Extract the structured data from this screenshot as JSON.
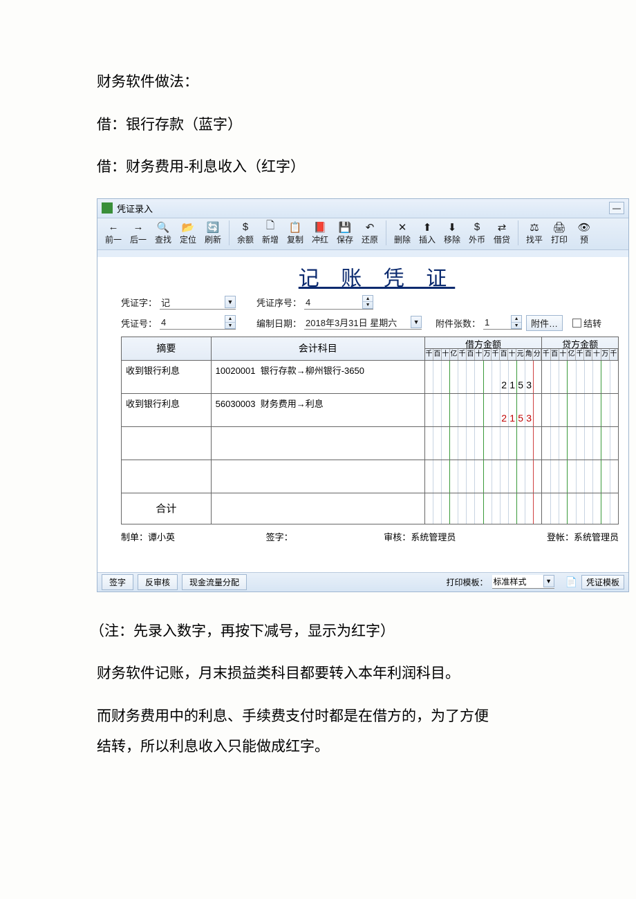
{
  "doc": {
    "p1": "财务软件做法：",
    "p2": "借：银行存款（蓝字）",
    "p3": "借：财务费用-利息收入（红字）",
    "note": "（注：先录入数字，再按下减号，显示为红字）",
    "p4": "财务软件记账，月末损益类科目都要转入本年利润科目。",
    "p5": "而财务费用中的利息、手续费支付时都是在借方的，为了方便",
    "p6": "结转，所以利息收入只能做成红字。"
  },
  "app": {
    "title": "凭证录入",
    "toolbar": [
      "前一",
      "后一",
      "查找",
      "定位",
      "刷新",
      "余额",
      "新增",
      "复制",
      "冲红",
      "保存",
      "还原",
      "删除",
      "插入",
      "移除",
      "外币",
      "借贷",
      "找平",
      "打印",
      "预"
    ],
    "voucher_title": "记 账 凭 证",
    "labels": {
      "word": "凭证字：",
      "seq": "凭证序号：",
      "num": "凭证号：",
      "date": "编制日期：",
      "attcount": "附件张数：",
      "attbtn": "附件…",
      "carry": "结转"
    },
    "fields": {
      "word": "记",
      "seq": "4",
      "num": "4",
      "date": "2018年3月31日 星期六",
      "attcount": "1"
    },
    "grid": {
      "headers": {
        "summary": "摘要",
        "acct": "会计科目",
        "debit": "借方金额",
        "credit": "贷方金额"
      },
      "units": [
        "千",
        "百",
        "十",
        "亿",
        "千",
        "百",
        "十",
        "万",
        "千",
        "百",
        "十",
        "元",
        "角",
        "分"
      ],
      "units_credit": [
        "千",
        "百",
        "十",
        "亿",
        "千",
        "百",
        "十",
        "万",
        "千"
      ],
      "rows": [
        {
          "summary": "收到银行利息",
          "code": "10020001",
          "acct": "银行存款→柳州银行-3650",
          "debit_digits": [
            "",
            "",
            "",
            "",
            "",
            "",
            "",
            "",
            "",
            "2",
            "1",
            "5",
            "3",
            ""
          ],
          "red": false
        },
        {
          "summary": "收到银行利息",
          "code": "56030003",
          "acct": "财务费用→利息",
          "debit_digits": [
            "",
            "",
            "",
            "",
            "",
            "",
            "",
            "",
            "",
            "2",
            "1",
            "5",
            "3",
            ""
          ],
          "red": true
        }
      ],
      "total": "合计"
    },
    "footer": {
      "maker_lbl": "制单：",
      "maker": "谭小英",
      "sign_lbl": "签字：",
      "audit_lbl": "审核：",
      "audit": "系统管理员",
      "post_lbl": "登帐：",
      "post": "系统管理员"
    },
    "btnbar": {
      "sign": "签字",
      "unaudit": "反审核",
      "cashflow": "现金流量分配",
      "tpl_lbl": "打印模板：",
      "tpl": "标准样式",
      "vtpl": "凭证模板"
    }
  }
}
